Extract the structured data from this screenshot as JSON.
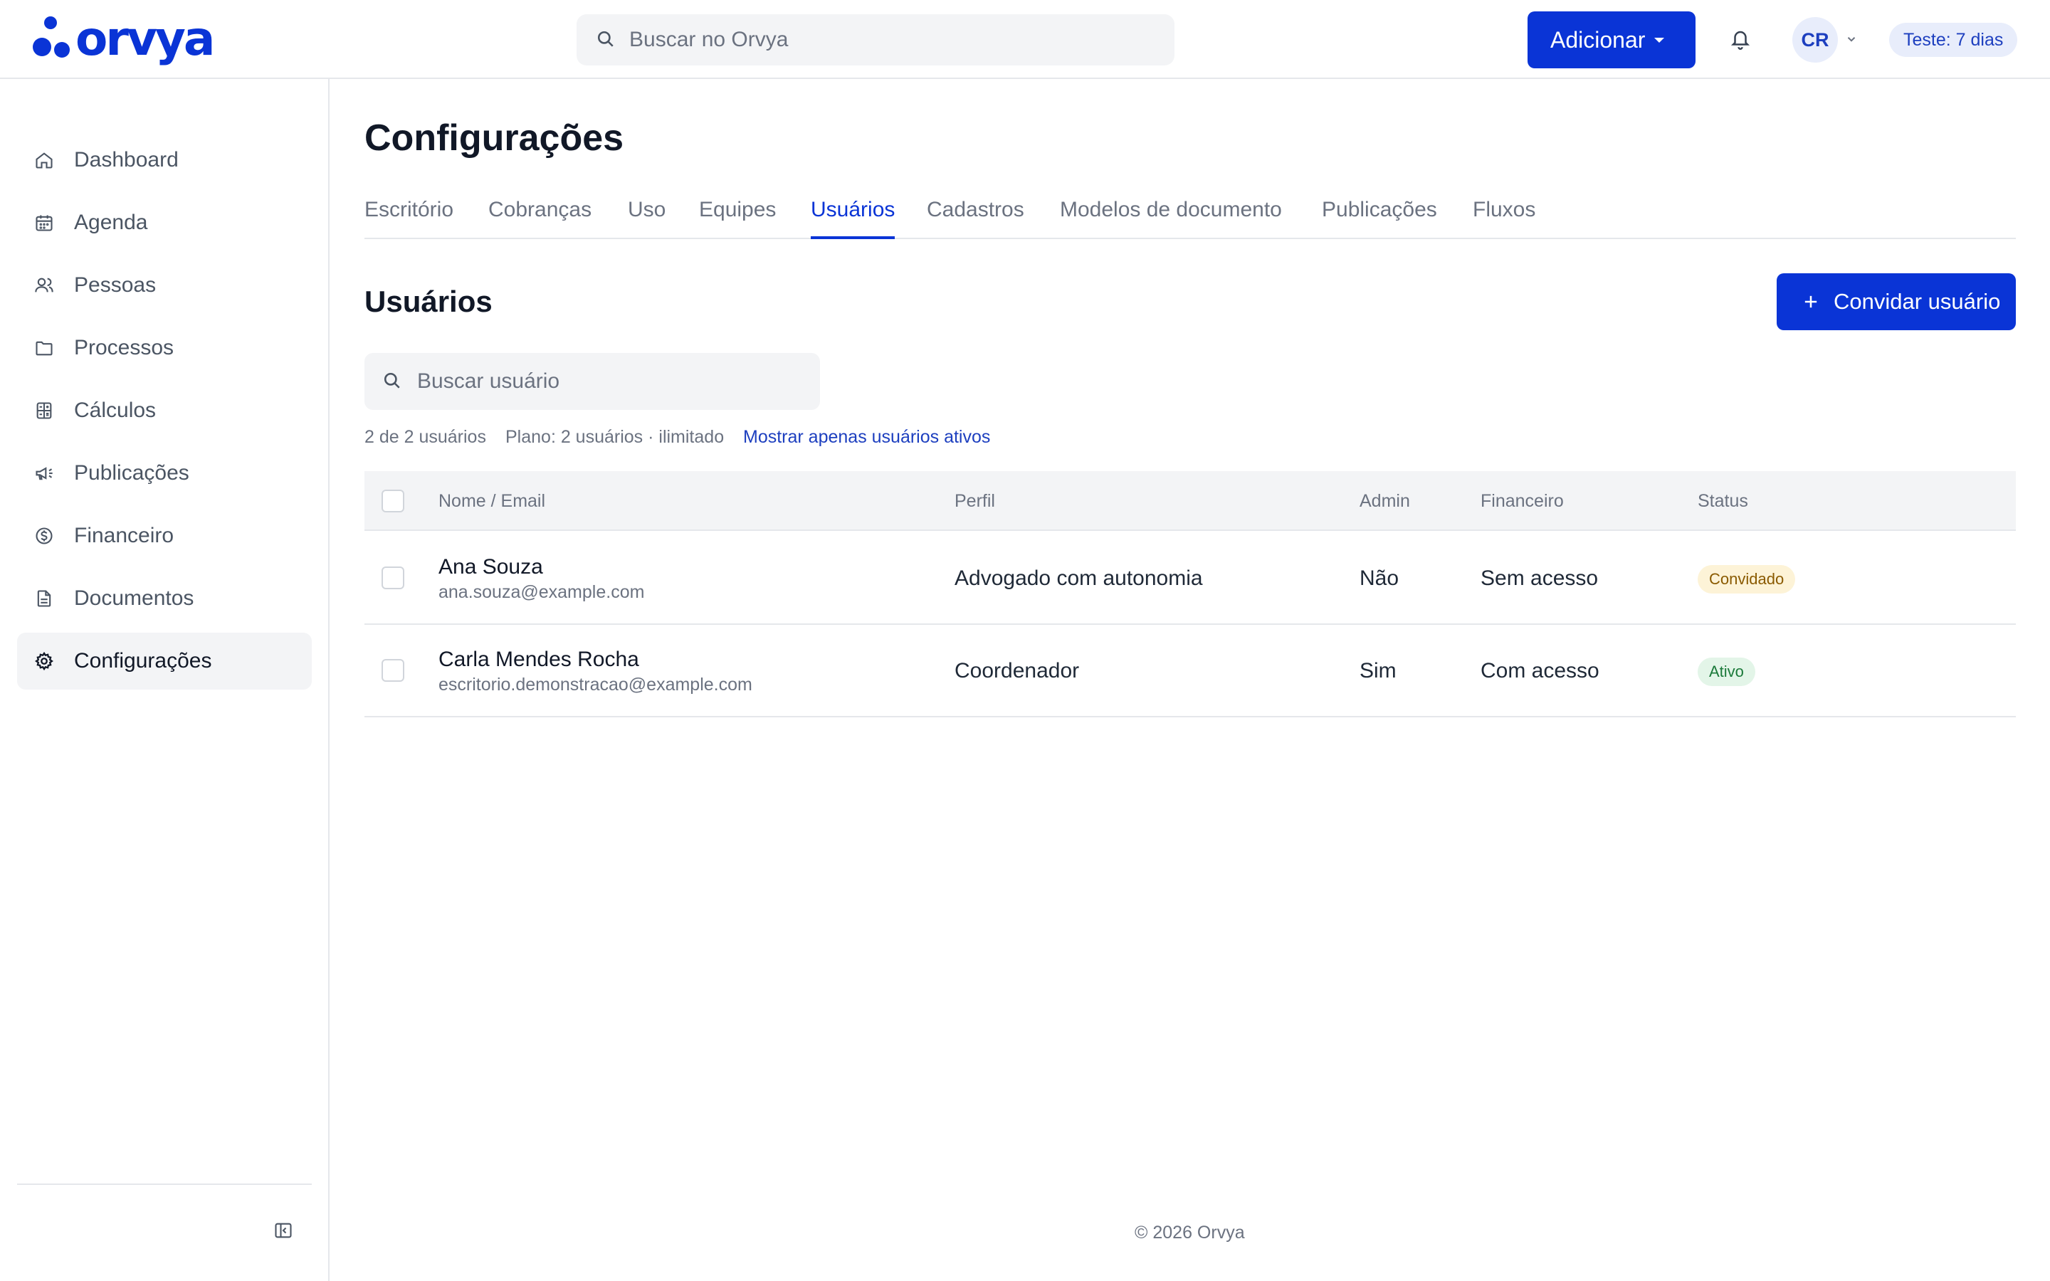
{
  "brand": {
    "name": "orvya",
    "color": "#0a34d6"
  },
  "header": {
    "search_placeholder": "Buscar no Orvya",
    "add_label": "Adicionar",
    "avatar_initials": "CR",
    "trial_label": "Teste: 7 dias"
  },
  "sidebar": {
    "items": [
      {
        "label": "Dashboard",
        "icon": "home-icon"
      },
      {
        "label": "Agenda",
        "icon": "calendar-icon"
      },
      {
        "label": "Pessoas",
        "icon": "users-icon"
      },
      {
        "label": "Processos",
        "icon": "folder-icon"
      },
      {
        "label": "Cálculos",
        "icon": "calculator-icon"
      },
      {
        "label": "Publicações",
        "icon": "megaphone-icon"
      },
      {
        "label": "Financeiro",
        "icon": "dollar-circle-icon"
      },
      {
        "label": "Documentos",
        "icon": "document-icon"
      },
      {
        "label": "Configurações",
        "icon": "gear-icon",
        "active": true
      }
    ]
  },
  "page": {
    "title": "Configurações",
    "tabs": [
      {
        "label": "Escritório"
      },
      {
        "label": "Cobranças"
      },
      {
        "label": "Uso"
      },
      {
        "label": "Equipes"
      },
      {
        "label": "Usuários",
        "active": true
      },
      {
        "label": "Cadastros"
      },
      {
        "label": "Modelos de documento"
      },
      {
        "label": "Publicações"
      },
      {
        "label": "Fluxos"
      }
    ]
  },
  "users": {
    "section_title": "Usuários",
    "invite_label": "Convidar usuário",
    "search_placeholder": "Buscar usuário",
    "count_text": "2 de 2 usuários",
    "plan_text": "Plano: 2 usuários · ilimitado",
    "filter_link": "Mostrar apenas usuários ativos",
    "columns": [
      "Nome / Email",
      "Perfil",
      "Admin",
      "Financeiro",
      "Status"
    ],
    "rows": [
      {
        "name": "Ana Souza",
        "email": "ana.souza@example.com",
        "profile": "Advogado com autonomia",
        "admin": "Não",
        "finance": "Sem acesso",
        "status": "Convidado"
      },
      {
        "name": "Carla Mendes Rocha",
        "email": "escritorio.demonstracao@example.com",
        "profile": "Coordenador",
        "admin": "Sim",
        "finance": "Com acesso",
        "status": "Ativo"
      }
    ]
  },
  "footer": {
    "text": "© 2026 Orvya"
  }
}
